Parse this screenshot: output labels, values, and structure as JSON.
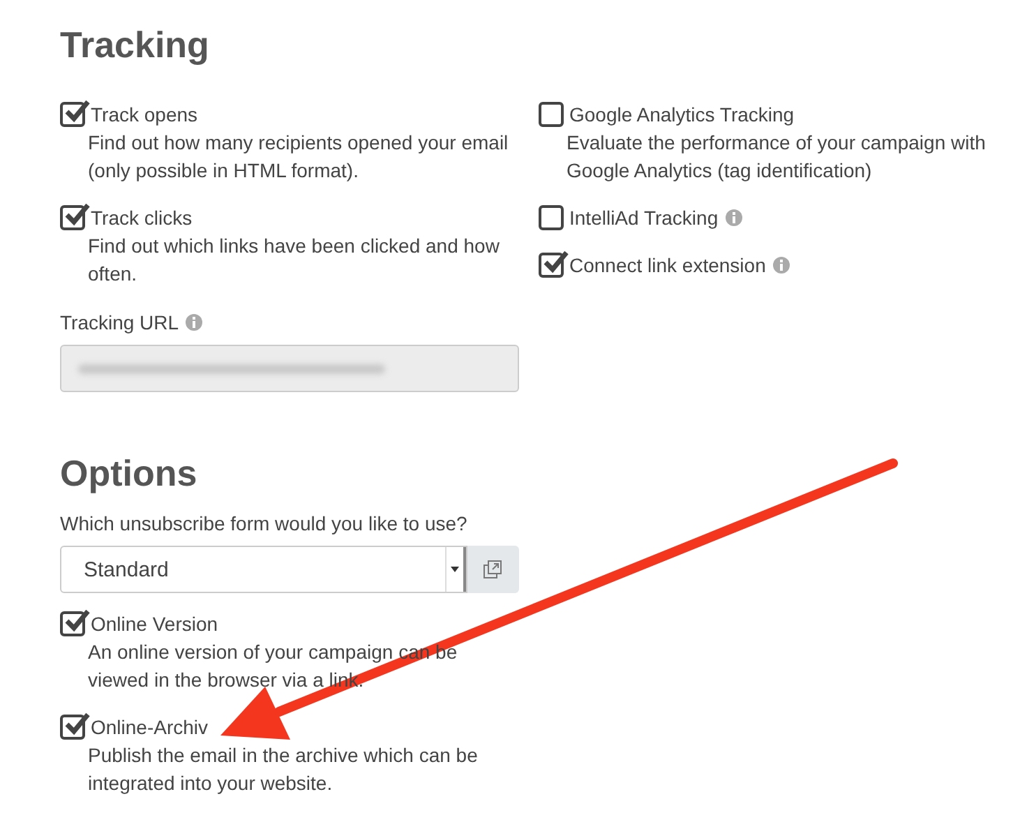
{
  "tracking": {
    "title": "Tracking",
    "left": [
      {
        "label": "Track opens",
        "checked": true,
        "description": "Find out how many recipients opened your email (only possible in HTML format)."
      },
      {
        "label": "Track clicks",
        "checked": true,
        "description": "Find out which links have been clicked and how often."
      }
    ],
    "right": [
      {
        "label": "Google Analytics Tracking",
        "checked": false,
        "info": false,
        "description": "Evaluate the performance of your campaign with Google Analytics (tag identification)"
      },
      {
        "label": "IntelliAd Tracking",
        "checked": false,
        "info": true
      },
      {
        "label": "Connect link extension",
        "checked": true,
        "info": true
      }
    ],
    "url_label": "Tracking URL"
  },
  "options": {
    "title": "Options",
    "unsubscribe_label": "Which unsubscribe form would you like to use?",
    "unsubscribe_value": "Standard",
    "items": [
      {
        "label": "Online Version",
        "checked": true,
        "description": "An online version of your campaign can be viewed in the browser via a link."
      },
      {
        "label": "Online-Archiv",
        "checked": true,
        "description": "Publish the email in the archive which can be integrated into your website."
      }
    ]
  }
}
